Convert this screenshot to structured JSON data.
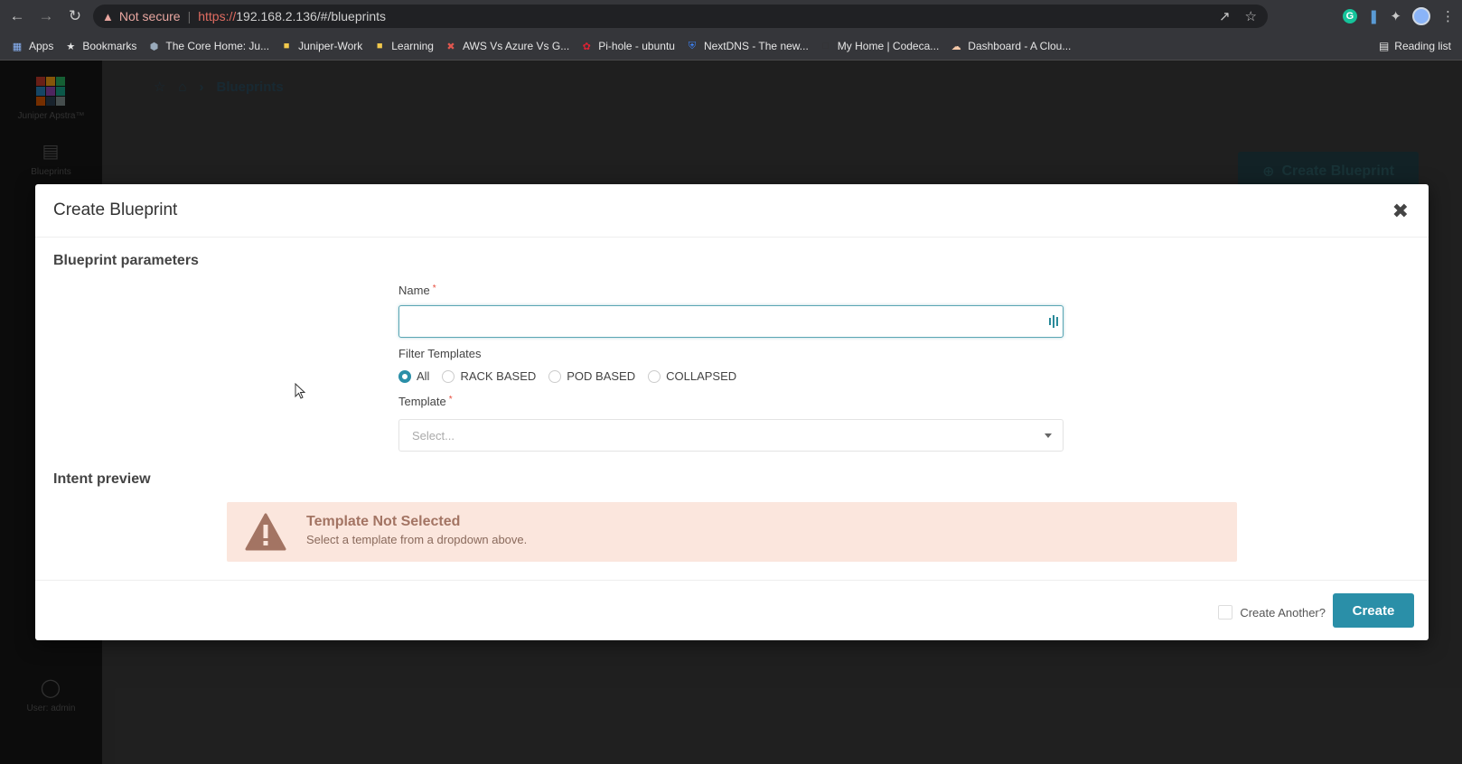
{
  "browser": {
    "security_label": "Not secure",
    "url_scheme": "https://",
    "url_rest": "192.168.2.136/#/blueprints",
    "bookmarks": [
      {
        "label": "Apps",
        "icon": "apps-grid-icon"
      },
      {
        "label": "Bookmarks",
        "icon": "star-icon"
      },
      {
        "label": "The Core Home: Ju...",
        "icon": "site-icon"
      },
      {
        "label": "Juniper-Work",
        "icon": "folder-icon"
      },
      {
        "label": "Learning",
        "icon": "folder-icon"
      },
      {
        "label": "AWS Vs Azure Vs G...",
        "icon": "site-icon"
      },
      {
        "label": "Pi-hole - ubuntu",
        "icon": "site-icon"
      },
      {
        "label": "NextDNS - The new...",
        "icon": "shield-icon"
      },
      {
        "label": "My Home | Codeca...",
        "icon": "site-icon"
      },
      {
        "label": "Dashboard - A Clou...",
        "icon": "cloud-icon"
      }
    ],
    "reading_list": "Reading list"
  },
  "app": {
    "logo_text": "Juniper Apstra™",
    "sidebar": {
      "blueprints": "Blueprints",
      "user": "User: admin"
    },
    "breadcrumb": {
      "current": "Blueprints"
    },
    "create_blueprint_button": "Create Blueprint"
  },
  "modal": {
    "title": "Create Blueprint",
    "section_params": "Blueprint parameters",
    "name_label": "Name",
    "name_value": "",
    "required_mark": "*",
    "filter_label": "Filter Templates",
    "filter_options": [
      {
        "label": "All",
        "checked": true
      },
      {
        "label": "RACK BASED",
        "checked": false
      },
      {
        "label": "POD BASED",
        "checked": false
      },
      {
        "label": "COLLAPSED",
        "checked": false
      }
    ],
    "template_label": "Template",
    "template_placeholder": "Select...",
    "section_intent": "Intent preview",
    "alert_title": "Template Not Selected",
    "alert_message": "Select a template from a dropdown above.",
    "create_another_label": "Create Another?",
    "create_label": "Create"
  },
  "colors": {
    "primary": "#2a8fa8",
    "alert_bg": "#fbe6dd",
    "alert_text": "#a37463"
  }
}
